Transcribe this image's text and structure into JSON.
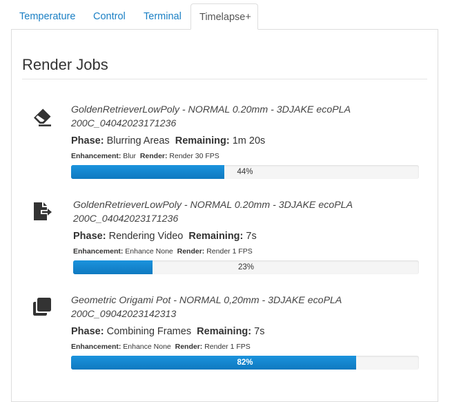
{
  "tabs": [
    {
      "label": "Temperature",
      "active": false
    },
    {
      "label": "Control",
      "active": false
    },
    {
      "label": "Terminal",
      "active": false
    },
    {
      "label": "Timelapse+",
      "active": true
    }
  ],
  "section": {
    "title": "Render Jobs"
  },
  "labels": {
    "phase": "Phase:",
    "remaining": "Remaining:",
    "enhancement": "Enhancement:",
    "render": "Render:"
  },
  "jobs": [
    {
      "icon": "eraser-icon",
      "title_line1": "GoldenRetrieverLowPoly - NORMAL 0.20mm - 3DJAKE ecoPLA",
      "title_line2": "200C_04042023171236",
      "phase": "Blurring Areas",
      "remaining": "1m 20s",
      "enhancement": "Blur",
      "render": "Render 30 FPS",
      "progress_percent": 44,
      "progress_label": "44%"
    },
    {
      "icon": "file-export-icon",
      "title_line1": "GoldenRetrieverLowPoly - NORMAL 0.20mm - 3DJAKE ecoPLA",
      "title_line2": "200C_04042023171236",
      "phase": "Rendering Video",
      "remaining": "7s",
      "enhancement": "Enhance None",
      "render": "Render 1 FPS",
      "progress_percent": 23,
      "progress_label": "23%"
    },
    {
      "icon": "copy-icon",
      "title_line1": "Geometric Origami Pot - NORMAL 0,20mm - 3DJAKE ecoPLA",
      "title_line2": "200C_09042023142313",
      "phase": "Combining Frames",
      "remaining": "7s",
      "enhancement": "Enhance None",
      "render": "Render 1 FPS",
      "progress_percent": 82,
      "progress_label": "82%"
    }
  ],
  "colors": {
    "tab_link": "#1a7fc4",
    "progress_bar": "#1486d0",
    "icon": "#333333"
  }
}
